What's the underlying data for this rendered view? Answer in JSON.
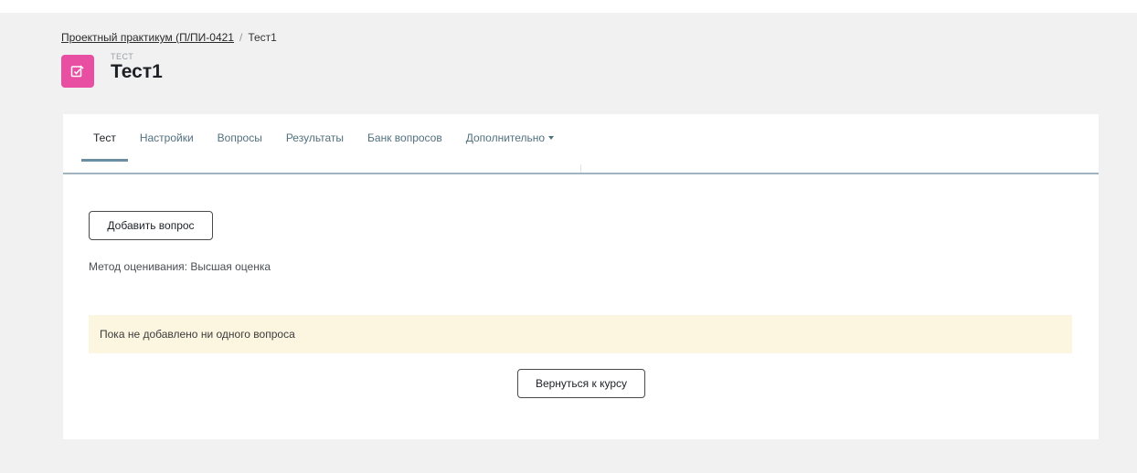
{
  "breadcrumb": {
    "course": "Проектный практикум (П/ПИ-0421",
    "separator": "/",
    "current": "Тест1"
  },
  "activity": {
    "icon": "quiz-edit-icon",
    "icon_color": "#e84fa3",
    "type_label": "ТЕСТ",
    "title": "Тест1"
  },
  "tabs": [
    {
      "label": "Тест",
      "active": true
    },
    {
      "label": "Настройки"
    },
    {
      "label": "Вопросы"
    },
    {
      "label": "Результаты"
    },
    {
      "label": "Банк вопросов"
    },
    {
      "label": "Дополнительно"
    }
  ],
  "main": {
    "add_question_label": "Добавить вопрос",
    "grading_method": "Метод оценивания: Высшая оценка",
    "empty_notice": "Пока не добавлено ни одного вопроса",
    "back_to_course_label": "Вернуться к курсу"
  }
}
